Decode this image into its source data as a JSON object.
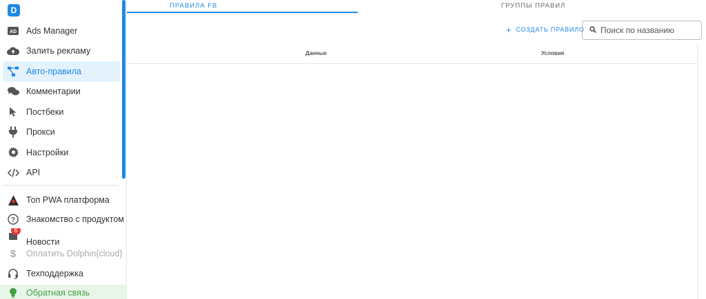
{
  "logo": {
    "letter": "D"
  },
  "sidebar": {
    "items": [
      {
        "label": "Ads Manager",
        "icon": "ad-icon",
        "glyph": "AD"
      },
      {
        "label": "Залить рекламу",
        "icon": "cloud-upload-icon",
        "glyph": "☁"
      },
      {
        "label": "Авто-правила",
        "icon": "sitemap-icon",
        "glyph": "⚯",
        "active": true
      },
      {
        "label": "Комментарии",
        "icon": "comments-icon",
        "glyph": "💬"
      },
      {
        "label": "Постбеки",
        "icon": "cursor-icon",
        "glyph": "➤"
      },
      {
        "label": "Прокси",
        "icon": "plug-icon",
        "glyph": "⏚"
      },
      {
        "label": "Настройки",
        "icon": "gear-icon",
        "glyph": "⚙"
      },
      {
        "label": "API",
        "icon": "code-icon",
        "glyph": "</>"
      }
    ],
    "bottom": [
      {
        "label": "Топ PWA платформа",
        "icon": "pwa-logo-icon"
      },
      {
        "label": "Знакомство с продуктом",
        "icon": "help-circle-icon"
      },
      {
        "label": "Новости",
        "icon": "news-icon",
        "badge": "6"
      },
      {
        "label": "Оплатить Dolphin{cloud}",
        "icon": "dollar-icon"
      },
      {
        "label": "Техподдержка",
        "icon": "headset-icon"
      },
      {
        "label": "Обратная связь",
        "icon": "lightbulb-icon"
      }
    ]
  },
  "tabs": {
    "fb_rules": "Правила FB",
    "rule_groups": "Группы правил"
  },
  "toolbar": {
    "create_label": "СОЗДАТЬ ПРАВИЛО",
    "search_placeholder": "Поиск по названию"
  },
  "table": {
    "columns": [
      "Данные",
      "Условия"
    ]
  },
  "colors": {
    "accent": "#1e88e5",
    "active_bg": "#e3f2fd",
    "feedback": "#43a047",
    "badge": "#e53935"
  }
}
